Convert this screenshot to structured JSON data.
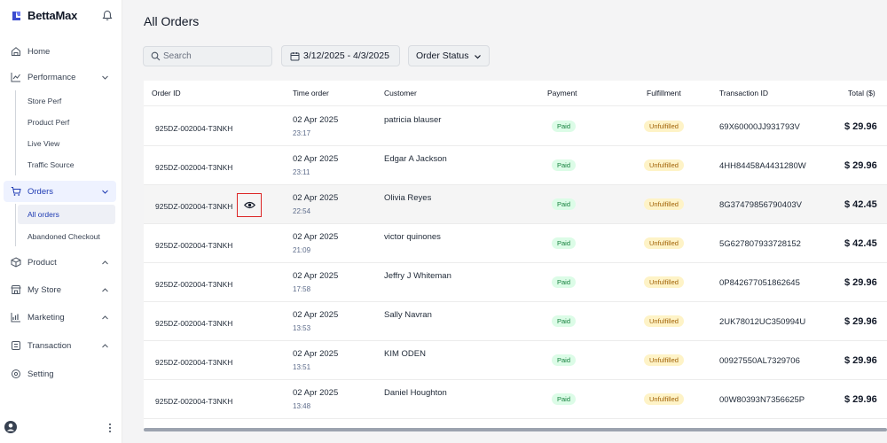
{
  "app": {
    "name": "BettaMax"
  },
  "sidebar": {
    "items": [
      {
        "label": "Home",
        "icon": "home-icon"
      },
      {
        "label": "Performance",
        "icon": "chart-icon"
      },
      {
        "label": "Orders",
        "icon": "cart-icon"
      },
      {
        "label": "Product",
        "icon": "box-icon"
      },
      {
        "label": "My Store",
        "icon": "store-icon"
      },
      {
        "label": "Marketing",
        "icon": "marketing-icon"
      },
      {
        "label": "Transaction",
        "icon": "transaction-icon"
      },
      {
        "label": "Setting",
        "icon": "gear-icon"
      }
    ],
    "performance_sub": [
      "Store Perf",
      "Product Perf",
      "Live View",
      "Traffic Source"
    ],
    "orders_sub": [
      "All orders",
      "Abandoned Checkout"
    ]
  },
  "page": {
    "title": "All Orders"
  },
  "filters": {
    "search_placeholder": "Search",
    "date_range": "3/12/2025 - 4/3/2025",
    "status_label": "Order Status"
  },
  "table": {
    "headers": {
      "order_id": "Order ID",
      "time": "Time order",
      "customer": "Customer",
      "payment": "Payment",
      "fulfillment": "Fulfillment",
      "transaction": "Transaction ID",
      "total": "Total ($)"
    },
    "rows": [
      {
        "order_id": "925DZ-002004-T3NKH",
        "date": "02 Apr 2025",
        "time": "23:17",
        "customer": "patricia blauser",
        "payment": "Paid",
        "fulfillment": "Unfulfilled",
        "transaction": "69X60000JJ931793V",
        "total": "$ 29.96"
      },
      {
        "order_id": "925DZ-002004-T3NKH",
        "date": "02 Apr 2025",
        "time": "23:11",
        "customer": "Edgar A Jackson",
        "payment": "Paid",
        "fulfillment": "Unfulfilled",
        "transaction": "4HH84458A4431280W",
        "total": "$ 29.96"
      },
      {
        "order_id": "925DZ-002004-T3NKH",
        "date": "02 Apr 2025",
        "time": "22:54",
        "customer": "Olivia Reyes",
        "payment": "Paid",
        "fulfillment": "Unfulfilled",
        "transaction": "8G37479856790403V",
        "total": "$ 42.45"
      },
      {
        "order_id": "925DZ-002004-T3NKH",
        "date": "02 Apr 2025",
        "time": "21:09",
        "customer": "victor quinones",
        "payment": "Paid",
        "fulfillment": "Unfulfilled",
        "transaction": "5G627807933728152",
        "total": "$ 42.45"
      },
      {
        "order_id": "925DZ-002004-T3NKH",
        "date": "02 Apr 2025",
        "time": "17:58",
        "customer": "Jeffry J Whiteman",
        "payment": "Paid",
        "fulfillment": "Unfulfilled",
        "transaction": "0P842677051862645",
        "total": "$ 29.96"
      },
      {
        "order_id": "925DZ-002004-T3NKH",
        "date": "02 Apr 2025",
        "time": "13:53",
        "customer": "Sally Navran",
        "payment": "Paid",
        "fulfillment": "Unfulfilled",
        "transaction": "2UK78012UC350994U",
        "total": "$ 29.96"
      },
      {
        "order_id": "925DZ-002004-T3NKH",
        "date": "02 Apr 2025",
        "time": "13:51",
        "customer": "KIM ODEN",
        "payment": "Paid",
        "fulfillment": "Unfulfilled",
        "transaction": "00927550AL7329706",
        "total": "$ 29.96"
      },
      {
        "order_id": "925DZ-002004-T3NKH",
        "date": "02 Apr 2025",
        "time": "13:48",
        "customer": "Daniel Houghton",
        "payment": "Paid",
        "fulfillment": "Unfulfilled",
        "transaction": "00W80393N7356625P",
        "total": "$ 29.96"
      }
    ]
  },
  "colors": {
    "accent": "#1f3bb3",
    "paid_bg": "#dcfce7",
    "unfulfilled_bg": "#fef3c7",
    "highlight": "#dc2626"
  }
}
